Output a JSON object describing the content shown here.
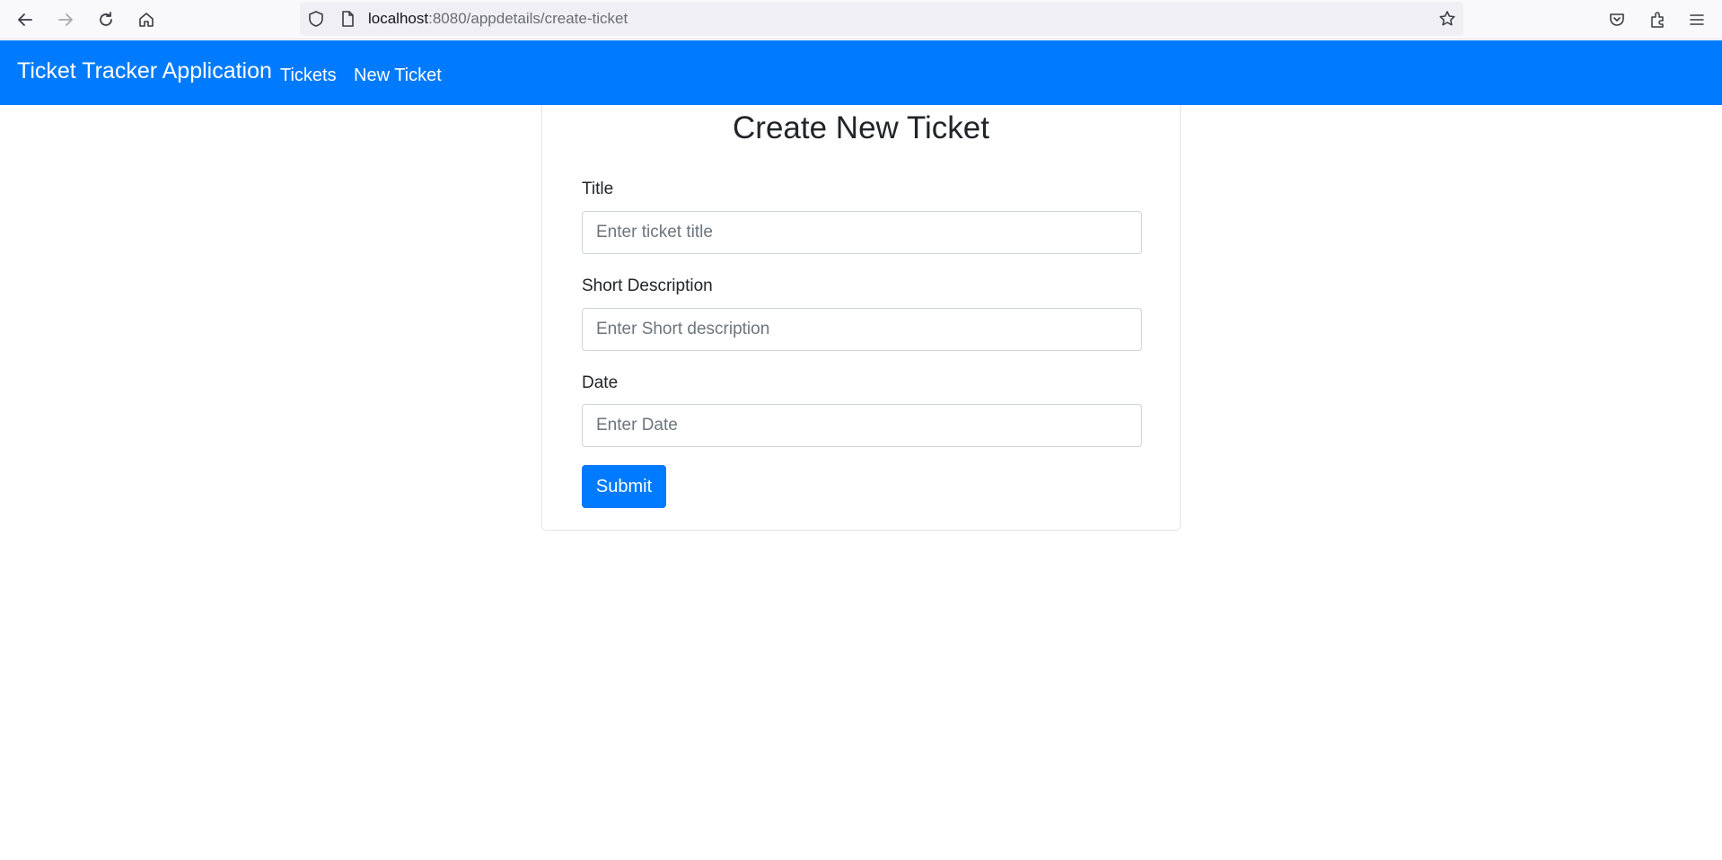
{
  "browser": {
    "url_host": "localhost",
    "url_rest": ":8080/appdetails/create-ticket",
    "icons": [
      "back-arrow-icon",
      "forward-arrow-icon",
      "reload-icon",
      "home-icon",
      "shield-icon",
      "page-icon",
      "bookmark-star-icon",
      "pocket-icon",
      "extensions-icon",
      "menu-icon"
    ]
  },
  "navbar": {
    "brand": "Ticket Tracker Application",
    "links": [
      {
        "label": "Tickets"
      },
      {
        "label": "New Ticket"
      }
    ],
    "color": "#007bff"
  },
  "form": {
    "heading": "Create New Ticket",
    "fields": [
      {
        "label": "Title",
        "placeholder": "Enter ticket title"
      },
      {
        "label": "Short Description",
        "placeholder": "Enter Short description"
      },
      {
        "label": "Date",
        "placeholder": "Enter Date"
      }
    ],
    "submit_label": "Submit"
  }
}
